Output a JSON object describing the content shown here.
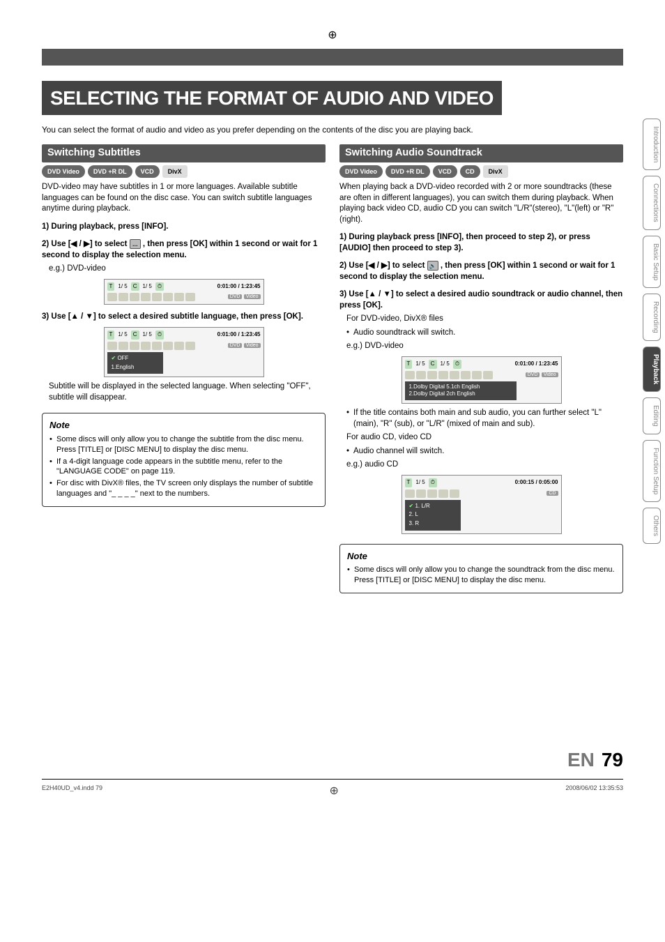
{
  "crosshair": "⊕",
  "page_title": "SELECTING THE FORMAT OF AUDIO AND VIDEO",
  "intro": "You can select the format of audio and video as you prefer depending on the contents of the disc you are playing back.",
  "left": {
    "header": "Switching Subtitles",
    "badges": [
      "DVD Video",
      "DVD +R DL",
      "VCD",
      "DivX"
    ],
    "para1": "DVD-video may have subtitles in 1 or more languages. Available subtitle languages can be found on the disc case. You can switch subtitle languages anytime during playback.",
    "step1": "1) During playback, press [INFO].",
    "step2_a": "2) Use [",
    "step2_arrows": "◀ / ▶",
    "step2_b": "] to select ",
    "step2_c": " , then press [OK] within 1 second or wait for 1 second to display the selection menu.",
    "eg1": "e.g.) DVD-video",
    "osd1": {
      "t": "T",
      "seq1": "1/ 5",
      "c": "C",
      "seq2": "1/ 5",
      "clock": "⏱",
      "time": "0:01:00 / 1:23:45",
      "tag1": "DVD",
      "tag2": "Video"
    },
    "step3_a": "3) Use [",
    "step3_arrows": "▲ / ▼",
    "step3_b": "] to select a desired subtitle language, then press [OK].",
    "osd2_menu": [
      "OFF",
      "1.English"
    ],
    "after_osd": "Subtitle will be displayed in the selected language. When selecting \"OFF\", subtitle will disappear.",
    "note_title": "Note",
    "notes": [
      "Some discs will only allow you to change the subtitle from the disc menu. Press [TITLE] or [DISC MENU] to display the disc menu.",
      "If a 4-digit language code appears in the subtitle menu, refer to the \"LANGUAGE CODE\" on page 119.",
      "For disc with DivX® files, the TV screen only displays the number of subtitle languages and \"_ _ _ _\" next to the numbers."
    ]
  },
  "right": {
    "header": "Switching Audio Soundtrack",
    "badges": [
      "DVD Video",
      "DVD +R DL",
      "VCD",
      "CD",
      "DivX"
    ],
    "para1": "When playing back a DVD-video recorded with 2 or more soundtracks (these are often in different languages), you can switch them during playback. When playing back video CD, audio CD you can switch \"L/R\"(stereo), \"L\"(left) or \"R\"(right).",
    "step1": "1) During playback press [INFO], then proceed to step 2), or press [AUDIO] then proceed to step 3).",
    "step2_a": "2) Use [",
    "step2_arrows": "◀ / ▶",
    "step2_b": "] to select ",
    "step2_c": " , then press [OK] within 1 second or wait for 1 second to display the selection menu.",
    "step3_a": "3) Use [",
    "step3_arrows": "▲ / ▼",
    "step3_b": "] to select a desired audio soundtrack or audio channel, then press [OK].",
    "sub_for": "For DVD-video, DivX® files",
    "sub_bullet1": "Audio soundtrack will switch.",
    "eg1": "e.g.) DVD-video",
    "osd1": {
      "time": "0:01:00 / 1:23:45",
      "tag1": "DVD",
      "tag2": "Video",
      "menu": [
        "1.Dolby Digital  5.1ch English",
        "2.Dolby Digital  2ch English"
      ]
    },
    "if_title": "If the title contains both main and sub audio, you can further select \"L\" (main), \"R\" (sub), or \"L/R\" (mixed of main and sub).",
    "sub_for2": "For audio CD, video CD",
    "sub_bullet2": "Audio channel will switch.",
    "eg2": "e.g.) audio CD",
    "osd2": {
      "time": "0:00:15 / 0:05:00",
      "tag": "CD",
      "menu": [
        "1. L/R",
        "2. L",
        "3. R"
      ]
    },
    "note_title": "Note",
    "notes": [
      "Some discs will only allow you to change the soundtrack from the disc menu. Press [TITLE] or [DISC MENU] to display the disc menu."
    ]
  },
  "tabs": [
    "Introduction",
    "Connections",
    "Basic Setup",
    "Recording",
    "Playback",
    "Editing",
    "Function Setup",
    "Others"
  ],
  "active_tab": "Playback",
  "footer": {
    "lang": "EN",
    "page": "79"
  },
  "print": {
    "left": "E2H40UD_v4.indd   79",
    "right": "2008/06/02   13:35:53"
  }
}
